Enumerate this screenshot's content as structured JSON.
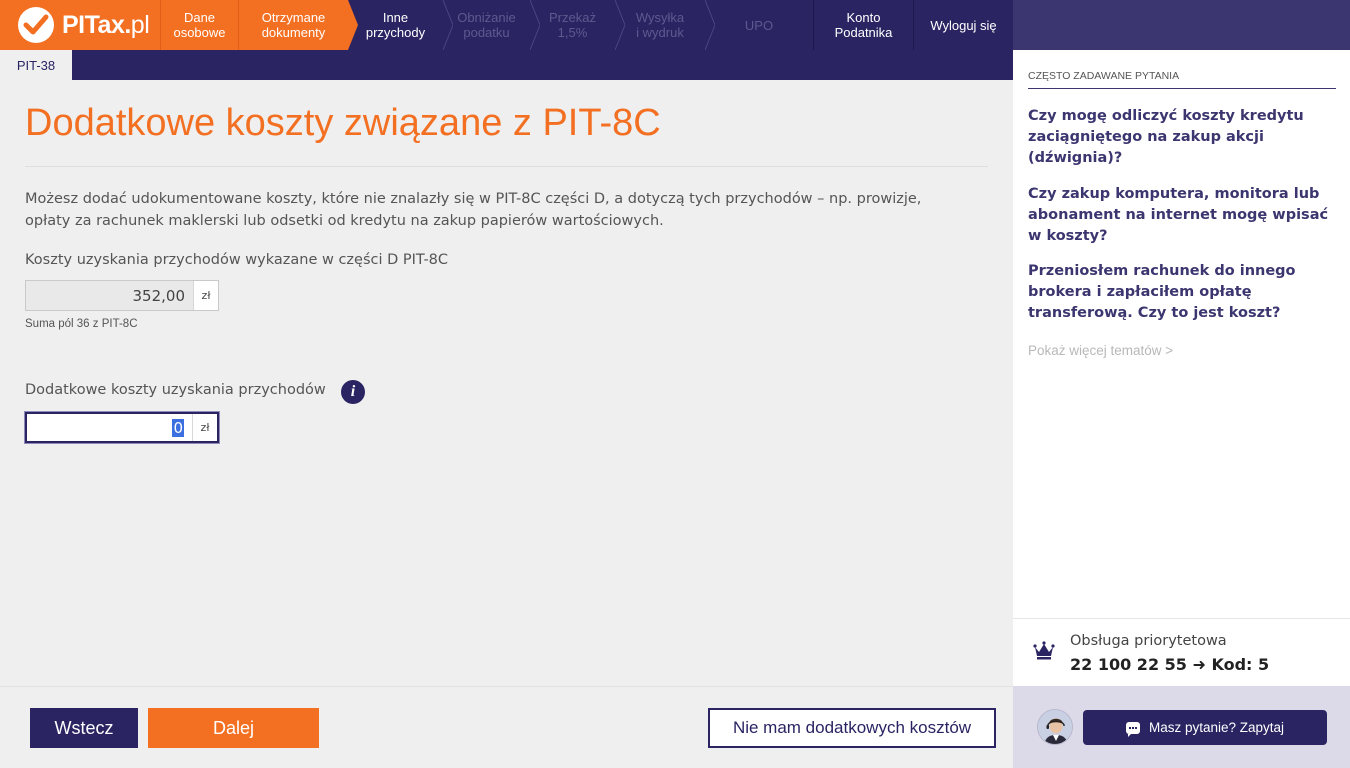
{
  "header": {
    "logo_text": "PITax",
    "logo_suffix": "pl",
    "steps": [
      {
        "label": "Dane\nosobowe",
        "state": "done"
      },
      {
        "label": "Otrzymane\ndokumenty",
        "state": "done"
      },
      {
        "label": "Inne\nprzychody",
        "state": "active"
      },
      {
        "label": "Obniżanie\npodatku",
        "state": "future"
      },
      {
        "label": "Przekaż\n1,5%",
        "state": "future"
      },
      {
        "label": "Wysyłka\ni wydruk",
        "state": "future"
      },
      {
        "label": "UPO",
        "state": "future"
      }
    ],
    "account_label": "Konto\nPodatnika",
    "logout_label": "Wyloguj się"
  },
  "subtab": {
    "label": "PIT-38"
  },
  "main": {
    "title": "Dodatkowe koszty związane z PIT-8C",
    "description": "Możesz dodać udokumentowane koszty, które nie znalazły się w PIT-8C części D, a dotyczą tych przychodów – np. prowizje, opłaty za rachunek maklerski lub odsetki od kredytu na zakup papierów wartościowych.",
    "field1": {
      "label": "Koszty uzyskania przychodów wykazane w części D PIT-8C",
      "value": "352,00",
      "unit": "zł",
      "hint": "Suma pól 36 z PIT-8C"
    },
    "field2": {
      "label": "Dodatkowe koszty uzyskania przychodów",
      "value": "0",
      "unit": "zł",
      "info_icon": "info-icon"
    }
  },
  "footer": {
    "back_label": "Wstecz",
    "next_label": "Dalej",
    "no_costs_label": "Nie mam dodatkowych kosztów"
  },
  "sidebar": {
    "faq_heading": "CZĘSTO ZADAWANE PYTANIA",
    "faq_items": [
      "Czy mogę odliczyć koszty kredytu zaciągniętego na zakup akcji (dźwignia)?",
      "Czy zakup komputera, monitora lub abonament na internet mogę wpisać w koszty?",
      "Przeniosłem rachunek do innego brokera i zapłaciłem opłatę transferową. Czy to jest koszt?"
    ],
    "more_label": "Pokaż więcej tematów >",
    "priority_label": "Obsługa priorytetowa",
    "priority_phone": "22 100 22 55 ➜ Kod: 5",
    "chat_label": "Masz pytanie? Zapytaj"
  },
  "colors": {
    "brand_orange": "#f36f21",
    "brand_navy": "#2a2463"
  }
}
